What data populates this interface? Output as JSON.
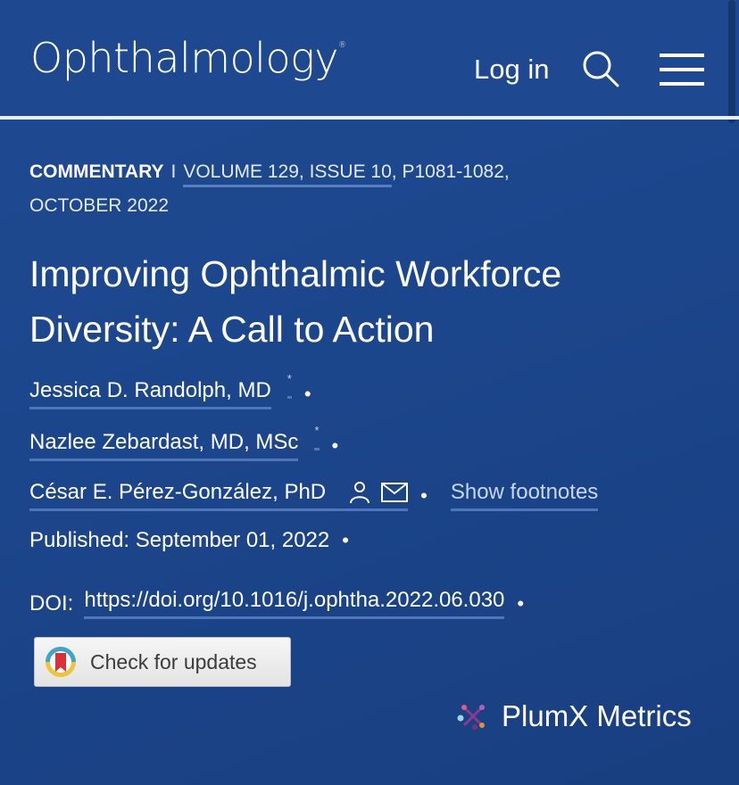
{
  "header": {
    "logo": "Ophthalmology",
    "logo_mark": "®",
    "login_label": "Log in"
  },
  "meta": {
    "type": "COMMENTARY",
    "separator": "I",
    "volume_issue": "VOLUME 129, ISSUE 10",
    "pages": ", P1081-1082,",
    "date": "OCTOBER 2022"
  },
  "article": {
    "title_line1": "Improving Ophthalmic Workforce",
    "title_line2": "Diversity: A Call to Action",
    "authors": [
      {
        "name": "Jessica D. Randolph, MD",
        "mark": "*"
      },
      {
        "name": "Nazlee Zebardast, MD, MSc",
        "mark": "*"
      },
      {
        "name": "César E. Pérez-González, PhD"
      }
    ],
    "bullet": "•",
    "show_footnotes": "Show footnotes",
    "published": "Published: September 01, 2022",
    "doi_label": "DOI:",
    "doi_url": "https://doi.org/10.1016/j.ophtha.2022.06.030"
  },
  "actions": {
    "check_updates": "Check for updates",
    "plumx": "PlumX Metrics"
  },
  "colors": {
    "background": "#1e4990",
    "link_underline": "#4f76b8",
    "divider": "#e9eef6"
  }
}
